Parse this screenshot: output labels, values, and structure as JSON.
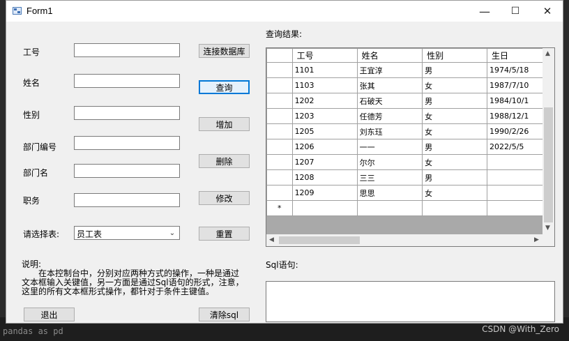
{
  "window": {
    "title": "Form1",
    "minimize": "—",
    "maximize": "☐",
    "close": "✕"
  },
  "form": {
    "fields": [
      {
        "label": "工号",
        "value": ""
      },
      {
        "label": "姓名",
        "value": ""
      },
      {
        "label": "性别",
        "value": ""
      },
      {
        "label": "部门编号",
        "value": ""
      },
      {
        "label": "部门名",
        "value": ""
      },
      {
        "label": "职务",
        "value": ""
      }
    ],
    "table_select_label": "请选择表:",
    "table_select_value": "员工表"
  },
  "buttons": {
    "connect": "连接数据库",
    "query": "查询",
    "add": "增加",
    "delete": "删除",
    "update": "修改",
    "reset": "重置",
    "exit": "退出",
    "clear_sql": "清除sql"
  },
  "note": {
    "title": "说明:",
    "body_line1": "在本控制台中，分别对应两种方式的操作，一种是通过",
    "body_line2": "文本框输入关键值，另一方面是通过Sql语句的形式，注意，",
    "body_line3": "这里的所有文本框形式操作，都针对于条件主键值。"
  },
  "results": {
    "label": "查询结果:",
    "columns": [
      "工号",
      "姓名",
      "性别",
      "生日"
    ],
    "rows": [
      [
        "1101",
        "王宜淳",
        "男",
        "1974/5/18"
      ],
      [
        "1103",
        "张其",
        "女",
        "1987/7/10"
      ],
      [
        "1202",
        "石破天",
        "男",
        "1984/10/1"
      ],
      [
        "1203",
        "任德芳",
        "女",
        "1988/12/1"
      ],
      [
        "1205",
        "刘东珏",
        "女",
        "1990/2/26"
      ],
      [
        "1206",
        "一一",
        "男",
        "2022/5/5"
      ],
      [
        "1207",
        "尔尔",
        "女",
        ""
      ],
      [
        "1208",
        "三三",
        "男",
        ""
      ],
      [
        "1209",
        "思思",
        "女",
        ""
      ]
    ],
    "new_row_marker": "*"
  },
  "sql": {
    "label": "Sql语句:",
    "value": ""
  },
  "background": {
    "code_text": "pandas as pd",
    "watermark": "CSDN @With_Zero"
  }
}
